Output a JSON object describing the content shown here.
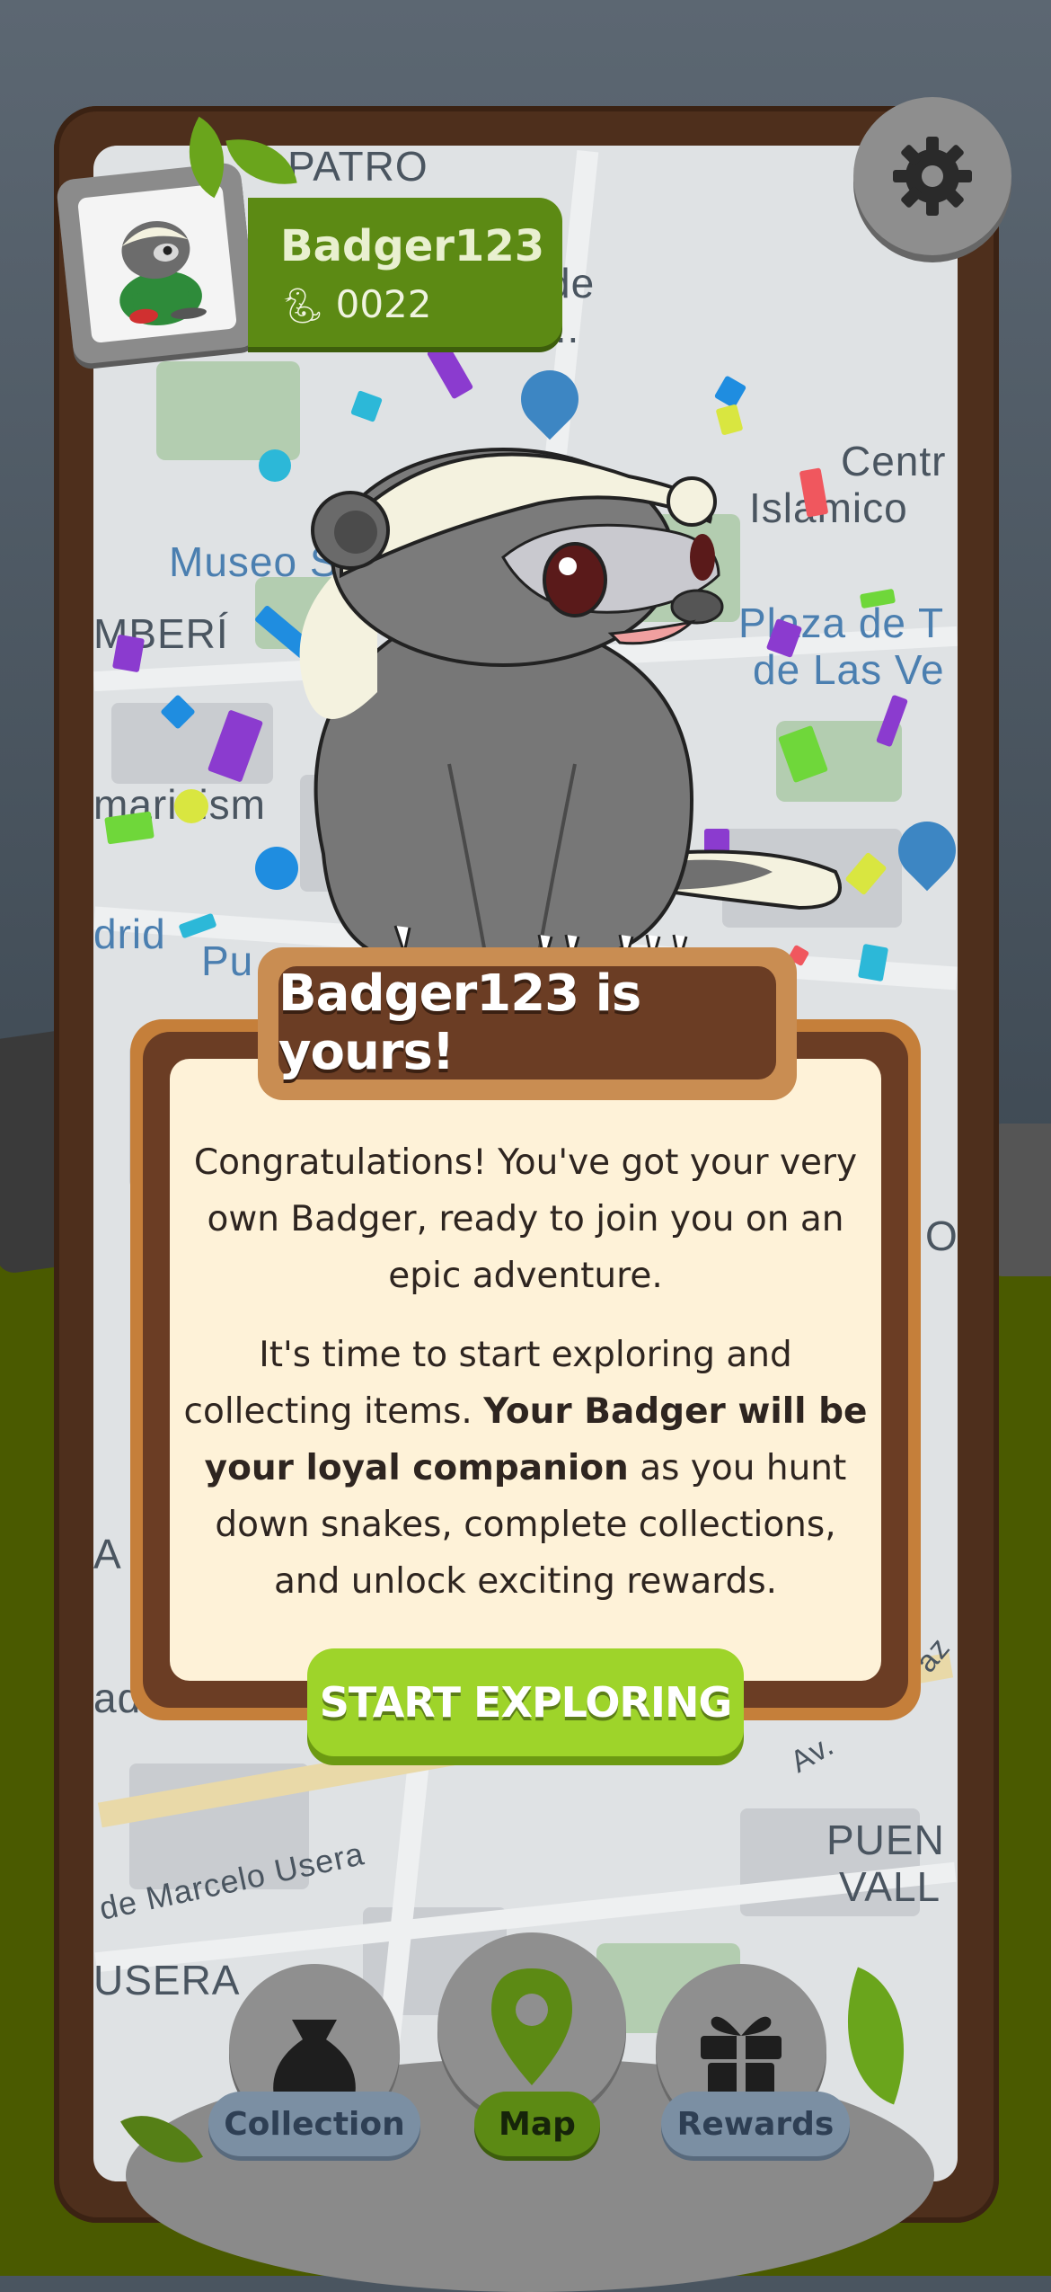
{
  "map": {
    "labels": [
      "PATRO",
      "l de",
      "s...",
      "Centr",
      "Islamico",
      "Museo S",
      "MBERÍ",
      "Plaza de T",
      "de Las Ve",
      "maricism",
      "drid",
      "Pu",
      "PUEN",
      "VALL",
      "de Marcelo Usera",
      "USERA",
      "Av.",
      "O",
      "A",
      "ad",
      "az"
    ]
  },
  "header": {
    "player_name": "Badger123",
    "snake_count": "0022",
    "settings_icon": "gear-icon",
    "avatar_icon": "badger-avatar"
  },
  "dialog": {
    "title": "Badger123 is yours!",
    "paragraph1": "Congratulations! You've got your very own Badger, ready to join you on an epic adventure.",
    "paragraph2_start": "It's time to start exploring and collecting items. ",
    "paragraph2_bold": "Your Badger will be your loyal companion",
    "paragraph2_end": " as you hunt down snakes, complete collections, and unlock exciting rewards.",
    "cta_label": "START EXPLORING"
  },
  "nav": {
    "items": [
      {
        "label": "Collection",
        "icon": "bag-icon",
        "active": false
      },
      {
        "label": "Map",
        "icon": "map-pin-icon",
        "active": true
      },
      {
        "label": "Rewards",
        "icon": "gift-icon",
        "active": false
      }
    ]
  },
  "colors": {
    "frame": "#4e2f1c",
    "accent_green": "#9ed42a",
    "card_bg": "#fef2d8",
    "title_bg": "#6b3d24"
  }
}
